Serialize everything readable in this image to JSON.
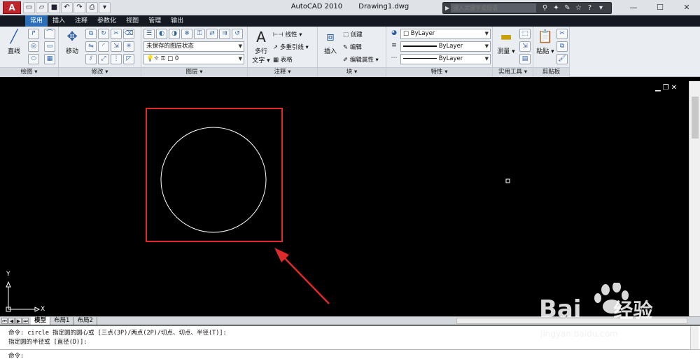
{
  "window": {
    "app": "AutoCAD 2010",
    "file": "Drawing1.dwg"
  },
  "search": {
    "placeholder": "键入关键字或短语"
  },
  "ribbon": {
    "tabs": [
      "常用",
      "插入",
      "注释",
      "参数化",
      "视图",
      "管理",
      "输出"
    ],
    "active_tab": "常用",
    "panels": {
      "draw": {
        "title": "绘图",
        "line_label": "直线"
      },
      "modify": {
        "title": "修改",
        "move_label": "移动"
      },
      "layers": {
        "title": "图层",
        "state": "未保存的图层状态",
        "current_layer": "0"
      },
      "annotation": {
        "title": "注释",
        "mtext_line1": "多行",
        "mtext_line2": "文字",
        "linear": "线性",
        "multileader": "多重引线",
        "table": "表格"
      },
      "block": {
        "title": "块",
        "insert": "插入",
        "create": "创建",
        "edit": "编辑",
        "edit_attr": "编辑属性"
      },
      "properties": {
        "title": "特性",
        "color": "ByLayer",
        "linetype": "ByLayer",
        "lineweight": "ByLayer"
      },
      "utilities": {
        "title": "实用工具",
        "measure": "测量"
      },
      "clipboard": {
        "title": "剪贴板",
        "paste": "粘贴"
      }
    }
  },
  "drawing": {
    "ucs_x": "X",
    "ucs_y": "Y"
  },
  "layout_tabs": [
    "模型",
    "布局1",
    "布局2"
  ],
  "active_layout": "模型",
  "command": {
    "history": [
      "命令:  circle 指定圆的圆心或 [三点(3P)/两点(2P)/切点、切点、半径(T)]:",
      "指定圆的半径或 [直径(D)]:"
    ],
    "prompt": "命令:"
  },
  "watermark": {
    "brand": "Bai",
    "brand2": "经验",
    "url": "jingyan.baidu.com"
  },
  "colors": {
    "annotation_red": "#e0292b",
    "ribbon_active_tab": "#2d6fb7"
  }
}
